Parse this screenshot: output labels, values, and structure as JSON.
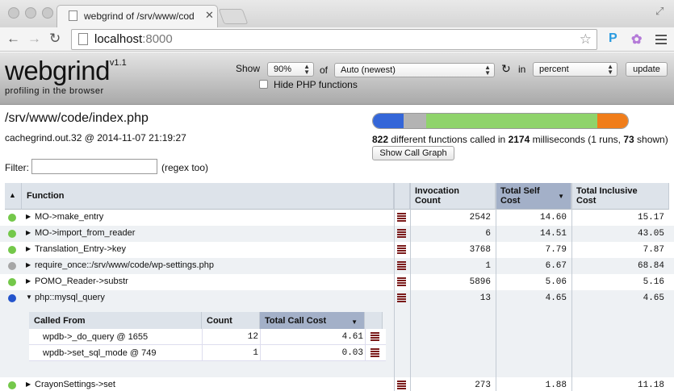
{
  "browser": {
    "tab_title": "webgrind of /srv/www/cod",
    "url_host": "localhost",
    "url_port": ":8000"
  },
  "header": {
    "logo": "webgrind",
    "version": "v1.1",
    "tagline": "profiling in the browser",
    "show_label": "Show",
    "show_value": "90%",
    "of_label": "of",
    "file_value": "Auto (newest)",
    "in_label": "in",
    "unit_value": "percent",
    "update_label": "update",
    "hide_php_label": "Hide PHP functions"
  },
  "file": {
    "path": "/srv/www/code/index.php",
    "info": "cachegrind.out.32 @ 2014-11-07 21:19:27",
    "functions_count": "822",
    "summary_mid": " different functions called in ",
    "ms": "2174",
    "summary_end": " milliseconds (1 runs, ",
    "shown": "73",
    "summary_tail": " shown)",
    "call_graph_label": "Show Call Graph",
    "breakdown": [
      {
        "label": "internal",
        "fraction": 0.12,
        "color": "#3466d8"
      },
      {
        "label": "include",
        "fraction": 0.09,
        "color": "#b3b3b3"
      },
      {
        "label": "procedural",
        "fraction": 0.67,
        "color": "#8fd36b"
      },
      {
        "label": "class",
        "fraction": 0.12,
        "color": "#f07d1a"
      }
    ]
  },
  "filter": {
    "label": "Filter:",
    "value": "",
    "hint": "(regex too)"
  },
  "table": {
    "headers": {
      "function": "Function",
      "invocation": "Invocation\nCount",
      "self": "Total Self\nCost",
      "inclusive": "Total Inclusive\nCost"
    },
    "rows": [
      {
        "name": "MO->make_entry",
        "dot": "#74c84a",
        "invocation": "2542",
        "self": "14.60",
        "inclusive": "15.17"
      },
      {
        "name": "MO->import_from_reader",
        "dot": "#74c84a",
        "invocation": "6",
        "self": "14.51",
        "inclusive": "43.05"
      },
      {
        "name": "Translation_Entry->key",
        "dot": "#74c84a",
        "invocation": "3768",
        "self": "7.79",
        "inclusive": "7.87"
      },
      {
        "name": "require_once::/srv/www/code/wp-settings.php",
        "dot": "#a6a6a6",
        "invocation": "1",
        "self": "6.67",
        "inclusive": "68.84"
      },
      {
        "name": "POMO_Reader->substr",
        "dot": "#74c84a",
        "invocation": "5896",
        "self": "5.06",
        "inclusive": "5.16"
      },
      {
        "name": "php::mysql_query",
        "dot": "#2454cc",
        "invocation": "13",
        "self": "4.65",
        "inclusive": "4.65"
      },
      {
        "name": "CrayonSettings->set",
        "dot": "#74c84a",
        "invocation": "273",
        "self": "1.88",
        "inclusive": "11.18"
      }
    ]
  },
  "subtable": {
    "headers": {
      "called_from": "Called From",
      "count": "Count",
      "total": "Total Call Cost"
    },
    "rows": [
      {
        "caller": "wpdb->_do_query @ 1655",
        "count": "12",
        "cost": "4.61"
      },
      {
        "caller": "wpdb->set_sql_mode @ 749",
        "count": "1",
        "cost": "0.03"
      }
    ]
  }
}
